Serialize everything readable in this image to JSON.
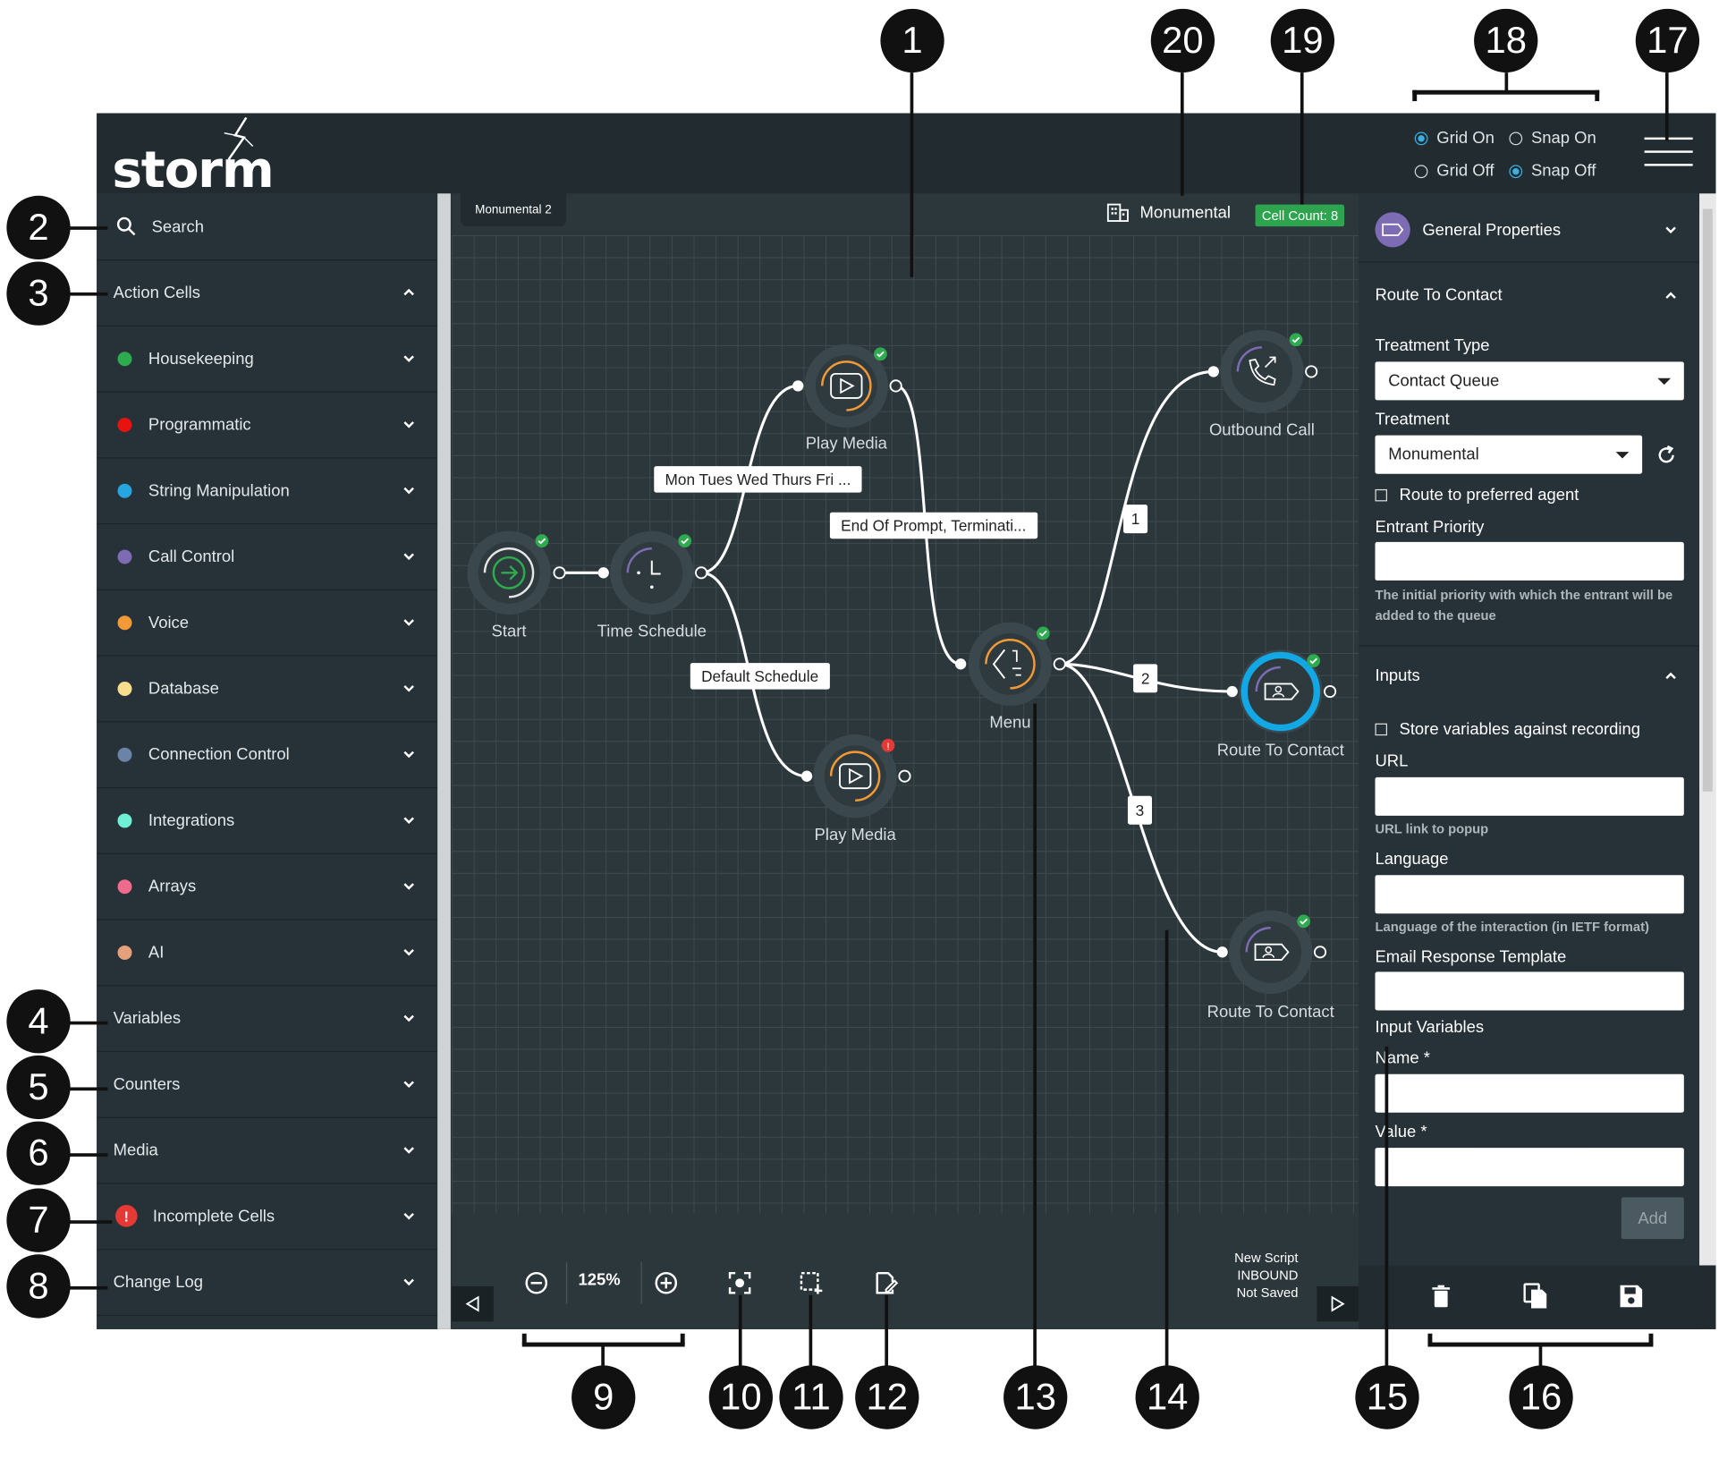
{
  "logo": "storm",
  "grid_options": [
    {
      "label": "Grid On",
      "selected": true
    },
    {
      "label": "Snap On",
      "selected": false
    },
    {
      "label": "Grid Off",
      "selected": false
    },
    {
      "label": "Snap Off",
      "selected": true
    }
  ],
  "sidebar": {
    "search_label": "Search",
    "action_cells_label": "Action Cells",
    "action_cells": [
      {
        "label": "Housekeeping",
        "color": "#2eaa4f"
      },
      {
        "label": "Programmatic",
        "color": "#e8130f"
      },
      {
        "label": "String Manipulation",
        "color": "#26a6e0"
      },
      {
        "label": "Call Control",
        "color": "#7d6bb3"
      },
      {
        "label": "Voice",
        "color": "#f39a36"
      },
      {
        "label": "Database",
        "color": "#f7de8f"
      },
      {
        "label": "Connection Control",
        "color": "#6a83a6"
      },
      {
        "label": "Integrations",
        "color": "#6ff0d4"
      },
      {
        "label": "Arrays",
        "color": "#ee6b8c"
      },
      {
        "label": "AI",
        "color": "#e4a07a"
      }
    ],
    "variables_label": "Variables",
    "counters_label": "Counters",
    "media_label": "Media",
    "incomplete_label": "Incomplete Cells",
    "changelog_label": "Change Log"
  },
  "canvas": {
    "tab": "Monumental 2",
    "tenant": "Monumental",
    "cell_count": "Cell Count: 8",
    "cells": {
      "start": "Start",
      "time_schedule": "Time Schedule",
      "play_media_1": "Play Media",
      "play_media_2": "Play Media",
      "menu": "Menu",
      "outbound_call": "Outbound Call",
      "route_contact_1": "Route To Contact",
      "route_contact_2": "Route To Contact"
    },
    "edge_labels": {
      "schedule_days": "Mon Tues Wed Thurs Fri ...",
      "end_of_prompt": "End Of Prompt, Terminati...",
      "default_schedule": "Default Schedule",
      "branch_1": "1",
      "branch_2": "2",
      "branch_3": "3"
    },
    "zoom": "125%",
    "status": {
      "line1": "New Script",
      "line2": "INBOUND",
      "line3": "Not Saved"
    }
  },
  "properties": {
    "general": "General Properties",
    "route_to_contact": "Route To Contact",
    "treatment_type_label": "Treatment Type",
    "treatment_type_value": "Contact Queue",
    "treatment_label": "Treatment",
    "treatment_value": "Monumental",
    "preferred_agent": "Route to preferred agent",
    "entrant_priority_label": "Entrant Priority",
    "entrant_priority_help": "The initial priority with which the entrant will be added to the queue",
    "inputs": "Inputs",
    "store_variables": "Store variables against recording",
    "url_label": "URL",
    "url_help": "URL link to popup",
    "language_label": "Language",
    "language_help": "Language of the interaction (in IETF format)",
    "email_template_label": "Email Response Template",
    "input_variables_label": "Input Variables",
    "name_label": "Name *",
    "value_label": "Value *",
    "add_button": "Add"
  },
  "callouts": [
    "1",
    "2",
    "3",
    "4",
    "5",
    "6",
    "7",
    "8",
    "9",
    "10",
    "11",
    "12",
    "13",
    "14",
    "15",
    "16",
    "17",
    "18",
    "19",
    "20"
  ]
}
